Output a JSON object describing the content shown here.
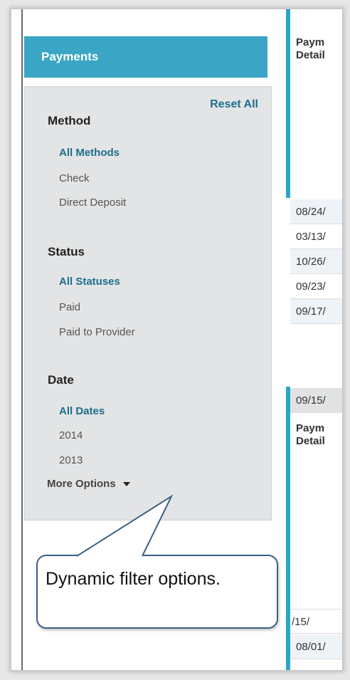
{
  "sidebar": {
    "header": "Payments",
    "reset_all": "Reset All",
    "method": {
      "title": "Method",
      "options": [
        "All Methods",
        "Check",
        "Direct Deposit"
      ]
    },
    "status": {
      "title": "Status",
      "options": [
        "All Statuses",
        "Paid",
        "Paid to Provider"
      ]
    },
    "date": {
      "title": "Date",
      "options": [
        "All Dates",
        "2014",
        "2013"
      ]
    },
    "more_options": "More Options"
  },
  "table": {
    "detail_label_1_line1": "Paym",
    "detail_label_1_line2": "Detail",
    "detail_label_2_line1": "Paym",
    "detail_label_2_line2": "Detail",
    "rows": [
      "08/24/",
      "03/13/",
      "10/26/",
      "09/23/",
      "09/17/",
      "09/15/",
      "/15/",
      "08/01/"
    ]
  },
  "callout": {
    "text": "Dynamic filter options."
  },
  "colors": {
    "accent": "#3aa5c4",
    "link": "#1c6f8c",
    "callout_border": "#3e6186"
  }
}
